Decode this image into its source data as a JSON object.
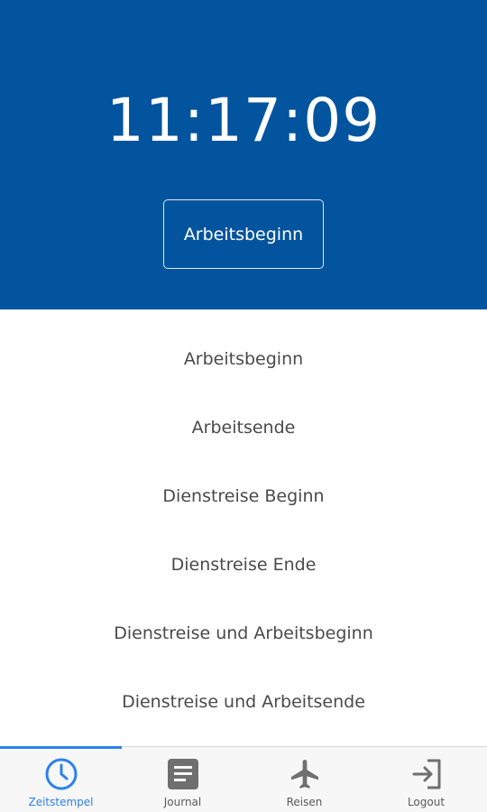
{
  "header": {
    "time": "11:17:09",
    "action_label": "Arbeitsbeginn"
  },
  "menu": {
    "items": [
      {
        "label": "Arbeitsbeginn"
      },
      {
        "label": "Arbeitsende"
      },
      {
        "label": "Dienstreise Beginn"
      },
      {
        "label": "Dienstreise Ende"
      },
      {
        "label": "Dienstreise und Arbeitsbeginn"
      },
      {
        "label": "Dienstreise und Arbeitsende"
      }
    ]
  },
  "tabbar": {
    "active": "Zeitstempel",
    "tabs": [
      {
        "label": "Zeitstempel",
        "icon": "clock-icon"
      },
      {
        "label": "Journal",
        "icon": "journal-icon"
      },
      {
        "label": "Reisen",
        "icon": "airplane-icon"
      },
      {
        "label": "Logout",
        "icon": "logout-icon"
      }
    ]
  },
  "colors": {
    "header_bg": "#03549e",
    "accent": "#2c80f0",
    "menu_text": "#4a4a4a",
    "tab_icon": "#6f6f6f"
  }
}
